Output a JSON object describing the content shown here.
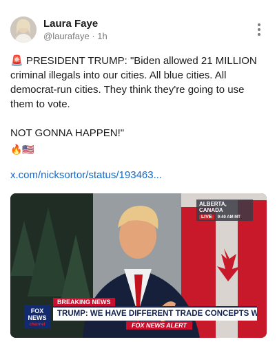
{
  "post": {
    "author_name": "Laura Faye",
    "handle": "@laurafaye",
    "separator": "·",
    "time_ago": "1h",
    "text": "🚨 PRESIDENT TRUMP: \"Biden allowed 21 MILLION criminal illegals into our cities. All blue cities. All democrat-run cities. They think they're going to use them to vote.\n\nNOT GONNA HAPPEN!\"",
    "emojis": "🔥🇺🇸",
    "link_text": "x.com/nicksortor/status/193463..."
  },
  "media": {
    "location_badge": "ALBERTA, CANADA",
    "live_label": "LIVE",
    "time_label": "9:40 AM MT",
    "breaking_label": "BREAKING NEWS",
    "headline": "TRUMP: WE HAVE DIFFERENT TRADE CONCEPTS W/ CANADA",
    "alert_label": "FOX NEWS ALERT",
    "logo_text": "FOX NEWS",
    "logo_sub": "channel"
  },
  "icons": {
    "more": "more-vertical-icon"
  },
  "colors": {
    "link": "#1568c9",
    "muted": "#7a7a7a",
    "breaking_red": "#c8102e",
    "fox_navy": "#142a6e"
  }
}
